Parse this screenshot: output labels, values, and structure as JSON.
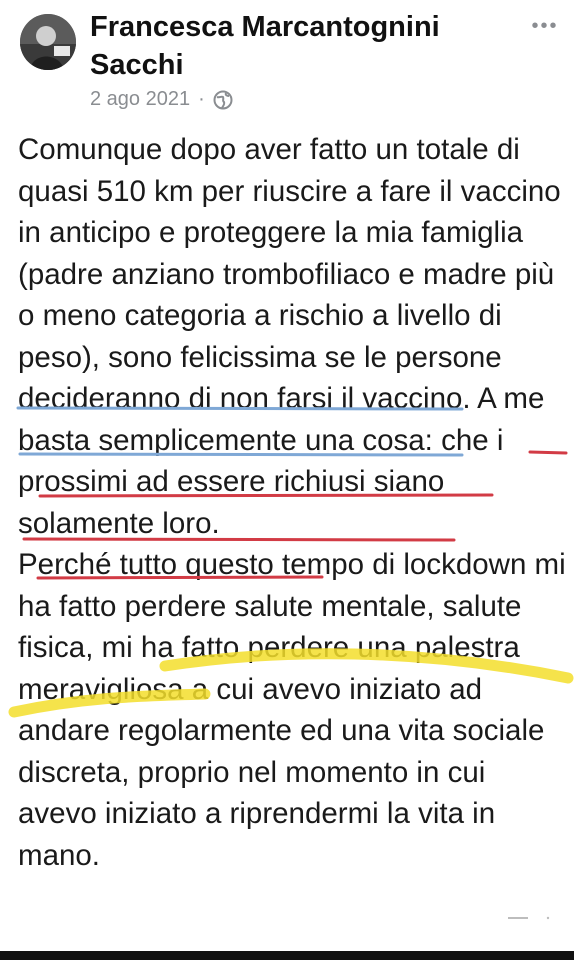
{
  "post": {
    "author": "Francesca Marcantognini Sacchi",
    "date": "2 ago 2021",
    "separator": "·",
    "more_label": "•••",
    "paragraph1": "Comunque dopo aver fatto un totale di quasi 510 km per riuscire a fare il vaccino in anticipo e proteggere la mia famiglia (padre anziano trombofiliaco e madre più o meno categoria a rischio a livello di peso), sono felicissima se le persone decideranno di non farsi il vaccino. A me basta semplicemente una cosa: che i prossimi ad essere richiusi siano solamente loro.",
    "paragraph2": "Perché tutto questo tempo di lockdown mi ha fatto perdere salute mentale, salute fisica, mi ha fatto perdere una palestra meravigliosa a cui avevo iniziato ad andare regolarmente ed una vita sociale discreta, proprio nel momento in cui avevo iniziato a riprendermi la vita in mano."
  },
  "icons": {
    "more": "more-options-icon",
    "audience": "globe-icon"
  },
  "colors": {
    "underline_blue": "#7fa8d6",
    "underline_red": "#d23b45",
    "highlighter_yellow": "#f3de2c",
    "meta_gray": "#8a8d91"
  }
}
